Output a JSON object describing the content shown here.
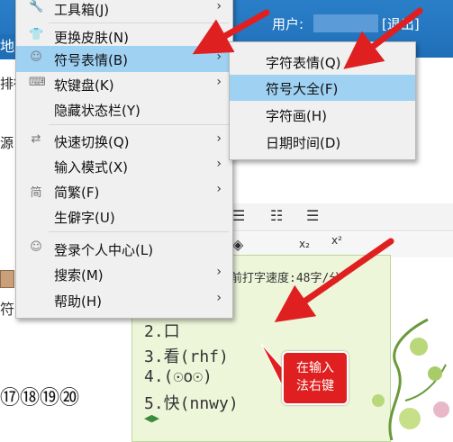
{
  "background": {
    "header": {
      "user_label": "用户:",
      "exit_label": "[退出]",
      "left_glyph": "地"
    },
    "left_fragments": [
      "排行",
      "源"
    ],
    "toolbar_glyphs": [
      "☰",
      "☷",
      "☰"
    ],
    "ime": {
      "speed_text": "前打字速度:48字/分",
      "candidates": [
        "2.口",
        "3.看(rhf)",
        "4.(☉o☉)",
        "5.快(nnwy)"
      ],
      "nav_glyph": "◀▶"
    },
    "circled_numbers": "⑰⑱⑲⑳",
    "fu_char": "符"
  },
  "context_menu": {
    "items": [
      {
        "label": "工具箱(J)",
        "icon": "wrench-icon",
        "glyph": "🔧",
        "has_submenu": true
      },
      {
        "label": "更换皮肤(N)",
        "icon": "shirt-icon",
        "glyph": "👕",
        "has_submenu": false
      },
      {
        "label": "符号表情(B)",
        "icon": "smiley-icon",
        "glyph": "☺",
        "has_submenu": true,
        "highlighted": true
      },
      {
        "label": "软键盘(K)",
        "icon": "keyboard-icon",
        "glyph": "⌨",
        "has_submenu": true
      },
      {
        "label": "隐藏状态栏(Y)",
        "icon": "",
        "glyph": "",
        "has_submenu": false
      },
      {
        "label": "快速切换(Q)",
        "icon": "switch-icon",
        "glyph": "⇄",
        "has_submenu": true
      },
      {
        "label": "输入模式(X)",
        "icon": "",
        "glyph": "",
        "has_submenu": true
      },
      {
        "label": "简繁(F)",
        "icon": "simplified-icon",
        "glyph": "简",
        "has_submenu": true
      },
      {
        "label": "生僻字(U)",
        "icon": "",
        "glyph": "",
        "has_submenu": false
      },
      {
        "label": "登录个人中心(L)",
        "icon": "user-icon",
        "glyph": "☺",
        "has_submenu": false
      },
      {
        "label": "搜索(M)",
        "icon": "",
        "glyph": "",
        "has_submenu": true
      },
      {
        "label": "帮助(H)",
        "icon": "",
        "glyph": "",
        "has_submenu": true
      }
    ],
    "arrow_glyph": "›"
  },
  "submenu": {
    "items": [
      {
        "label": "字符表情(Q)"
      },
      {
        "label": "符号大全(F)",
        "highlighted": true
      },
      {
        "label": "字符画(H)"
      },
      {
        "label": "日期时间(D)"
      }
    ]
  },
  "callout": {
    "line1": "在输入",
    "line2": "法右键"
  },
  "colors": {
    "highlight": "#9fd1f3",
    "menu_bg": "#f0f0f0",
    "arrow": "#e02020",
    "header_blue": "#1f6fb8"
  }
}
